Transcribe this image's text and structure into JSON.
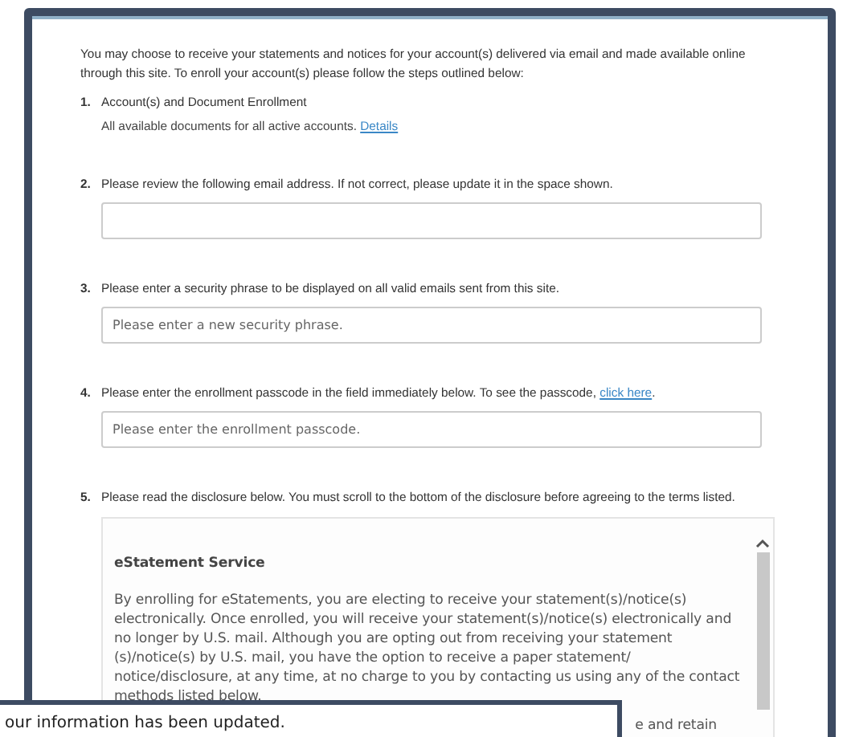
{
  "intro": "You may choose to receive your statements and notices for your account(s) delivered via email and made available online through this site. To enroll your account(s) please follow the steps outlined below:",
  "steps": [
    {
      "number": "1.",
      "kind": "info",
      "text": "Account(s) and Document Enrollment",
      "detail": "All available documents for all active accounts.",
      "link": "Details"
    },
    {
      "number": "2.",
      "kind": "field",
      "text": "Please review the following email address. If not correct, please update it in the space shown."
    },
    {
      "number": "3.",
      "kind": "field",
      "text": "Please enter a security phrase to be displayed on all valid emails sent from this site.",
      "placeholder": "Please enter a new security phrase."
    },
    {
      "number": "4.",
      "kind": "field",
      "text": "Please enter the enrollment passcode in the field immediately below. To see the passcode, ",
      "link": "click here",
      "after": ".",
      "placeholder": "Please enter the enrollment passcode."
    },
    {
      "number": "5.",
      "kind": "disclosure",
      "text": "Please read the disclosure below. You must scroll to the bottom of the disclosure before agreeing to the terms listed."
    }
  ],
  "disclosure": {
    "title": "eStatement Service",
    "paragraph": "By enrolling for eStatements, you are electing to receive your statement(s)/notice(s) electronically. Once enrolled, you will receive your statement(s)/notice(s) electronically and no longer by U.S. mail. Although you are opting out from receiving your statement (s)/notice(s) by U.S. mail, you have the option to receive a paper statement/ notice/disclosure, at any time, at no charge to you by contacting us using any of the contact methods listed below.",
    "fragment": "e and retain"
  },
  "toast": {
    "message": "our information has been updated."
  }
}
